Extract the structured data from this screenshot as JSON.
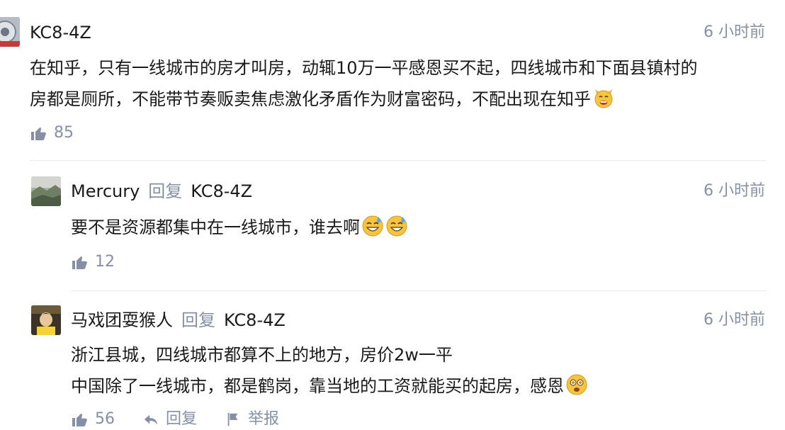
{
  "comments": [
    {
      "author": "KC8-4Z",
      "time": "6 小时前",
      "lines": [
        "在知乎，只有一线城市的房才叫房，动辄10万一平感恩买不起，四线城市和下面县镇村的",
        "房都是厕所，不能带节奏贩卖焦虑激化矛盾作为财富密码，不配出现在知乎"
      ],
      "likes": "85"
    },
    {
      "author": "Mercury",
      "reply_word": "回复",
      "reply_to": "KC8-4Z",
      "time": "6 小时前",
      "lines": [
        "要不是资源都集中在一线城市，谁去啊"
      ],
      "likes": "12"
    },
    {
      "author": "马戏团耍猴人",
      "reply_word": "回复",
      "reply_to": "KC8-4Z",
      "time": "6 小时前",
      "lines": [
        "浙江县城，四线城市都算不上的地方，房价2w一平",
        "中国除了一线城市，都是鹤岗，靠当地的工资就能买的起房，感恩"
      ],
      "likes": "56",
      "reply_action": "回复",
      "report_action": "举报"
    }
  ],
  "icons": {
    "like": "thumbs-up-icon",
    "reply": "reply-arrow-icon",
    "report": "flag-icon"
  },
  "colors": {
    "meta": "#8590a6",
    "text": "#1a1a1a",
    "divider": "#ebebeb"
  }
}
